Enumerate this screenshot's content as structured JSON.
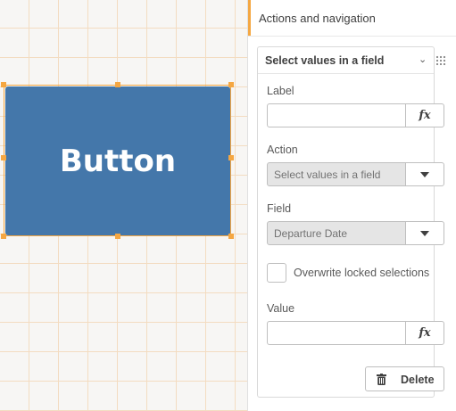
{
  "canvas": {
    "button_label": "Button"
  },
  "panel": {
    "header": "Actions and navigation",
    "action_card": {
      "title": "Select values in a field",
      "label_field": {
        "label": "Label",
        "value": "",
        "fx": "fx"
      },
      "action_field": {
        "label": "Action",
        "value": "Select values in a field"
      },
      "field_field": {
        "label": "Field",
        "value": "Departure Date"
      },
      "overwrite": {
        "label": "Overwrite locked selections",
        "checked": false
      },
      "value_field": {
        "label": "Value",
        "value": "",
        "fx": "fx"
      },
      "delete_label": "Delete"
    }
  },
  "colors": {
    "button_bg": "#4477aa",
    "selection": "#f5a742",
    "grid": "#f3dcc1"
  }
}
